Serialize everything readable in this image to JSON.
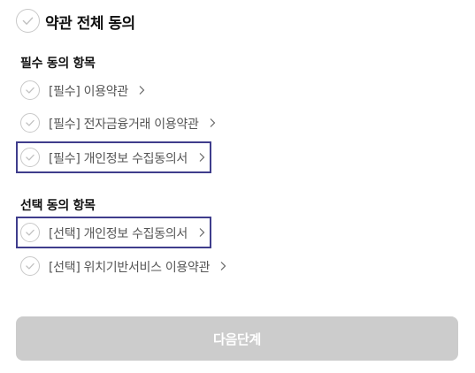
{
  "all_agree": {
    "label": "약관 전체 동의",
    "checked": false,
    "icon": "check-icon"
  },
  "required_section": {
    "title": "필수 동의 항목",
    "items": [
      {
        "label": "[필수] 이용약관",
        "checked": false
      },
      {
        "label": "[필수] 전자금융거래 이용약관",
        "checked": false
      },
      {
        "label": "[필수] 개인정보 수집동의서",
        "checked": false
      }
    ]
  },
  "optional_section": {
    "title": "선택 동의 항목",
    "items": [
      {
        "label": "[선택] 개인정보 수집동의서",
        "checked": false
      },
      {
        "label": "[선택] 위치기반서비스 이용약관",
        "checked": false
      }
    ]
  },
  "next_button": {
    "label": "다음단계",
    "enabled": false
  },
  "colors": {
    "focus_border": "#3f3d8c",
    "checkmark": "#c8c8c8",
    "button_disabled": "#cccccc"
  }
}
